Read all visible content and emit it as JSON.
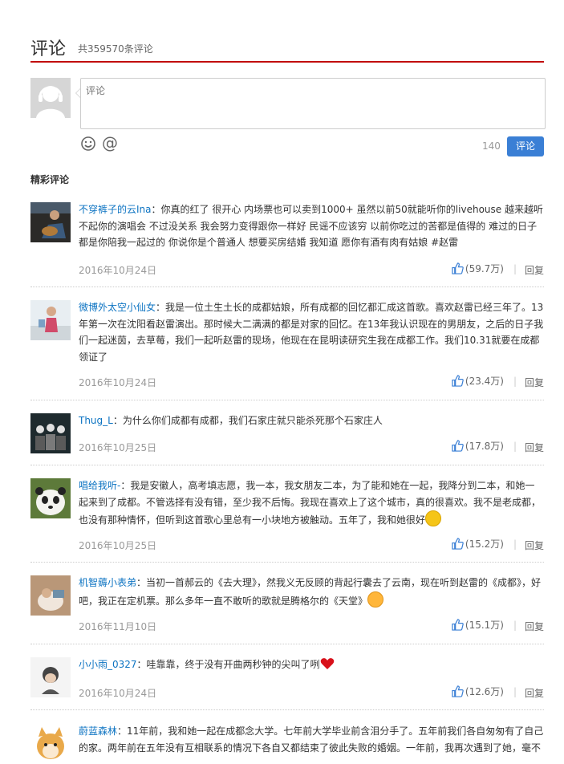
{
  "header": {
    "title": "评论",
    "count": "共359570条评论"
  },
  "composer": {
    "placeholder": "评论",
    "char_count": "140",
    "submit_label": "评论"
  },
  "section_title": "精彩评论",
  "comments": [
    {
      "user": "不穿裤子的云Ina",
      "text": "：你真的红了 很开心 内场票也可以卖到1000+ 虽然以前50就能听你的livehouse 越来越听不起你的演唱会 不过没关系 我会努力变得跟你一样好 民谣不应该穷 以前你吃过的苦都是值得的 难过的日子都是你陪我一起过的 你说你是个普通人 想要买房结婚 我知道 愿你有酒有肉有姑娘 #赵雷",
      "date": "2016年10月24日",
      "likes": "(59.7万)",
      "reply": "回复"
    },
    {
      "user": "微博外太空小仙女",
      "text": "：我是一位土生土长的成都姑娘，所有成都的回忆都汇成这首歌。喜欢赵雷已经三年了。13年第一次在沈阳看赵雷演出。那时候大二满满的都是对家的回忆。在13年我认识现在的男朋友，之后的日子我们一起迷茵，去草莓，我们一起听赵雷的现场，他现在在昆明读研究生我在成都工作。我们10.31就要在成都领证了",
      "date": "2016年10月24日",
      "likes": "(23.4万)",
      "reply": "回复"
    },
    {
      "user": "Thug_L",
      "text": "：为什么你们成都有成都，我们石家庄就只能杀死那个石家庄人",
      "date": "2016年10月25日",
      "likes": "(17.8万)",
      "reply": "回复"
    },
    {
      "user": "唱给我听-",
      "text": "：我是安徽人，高考填志愿，我一本，我女朋友二本，为了能和她在一起，我降分到二本，和她一起来到了成都。不管选择有没有错，至少我不后悔。我现在喜欢上了这个城市，真的很喜欢。我不是老成都，也没有那种情怀，但听到这首歌心里总有一小块地方被触动。五年了，我和她很好",
      "date": "2016年10月25日",
      "likes": "(15.2万)",
      "reply": "回复"
    },
    {
      "user": "机智薅小表弟",
      "text": "：当初一首郝云的《去大理》，然我义无反顾的背起行囊去了云南，现在听到赵雷的《成都》，好吧，我正在定机票。那么多年一直不敢听的歌就是腾格尔的《天堂》",
      "date": "2016年11月10日",
      "likes": "(15.1万)",
      "reply": "回复"
    },
    {
      "user": "小小雨_0327",
      "text": "：哇靠靠，终于没有开曲两秒钟的尖叫了咧",
      "date": "2016年10月24日",
      "likes": "(12.6万)",
      "reply": "回复"
    },
    {
      "user": "蔚蓝森林",
      "text": "：11年前，我和她一起在成都念大学。七年前大学毕业前含泪分手了。五年前我们各自匆匆有了自己的家。两年前在五年没有互相联系的情况下各自又都结束了彼此失败的婚姻。一年前，我再次遇到了她，毫不",
      "date": "",
      "likes": "",
      "reply": ""
    }
  ],
  "colors": {
    "accent_red": "#c20c0c",
    "link_blue": "#0c73c2",
    "button_blue": "#3a7fd5"
  },
  "icons": {
    "emoji": "smiley-icon",
    "at": "at-icon",
    "like": "thumbs-up-icon"
  }
}
